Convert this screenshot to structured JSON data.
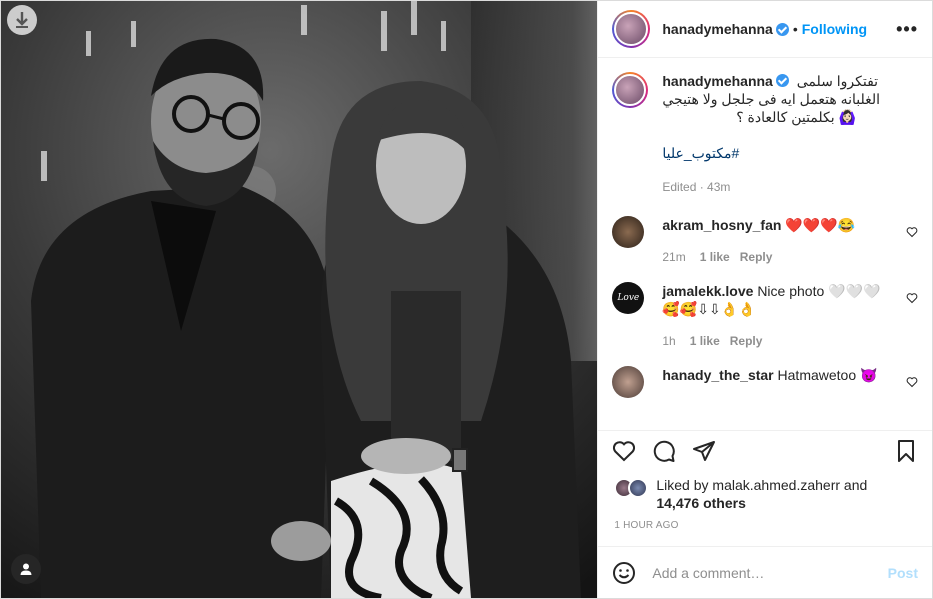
{
  "post": {
    "author": "hanadymehanna",
    "follow_status": "Following",
    "separator": "•",
    "more_label": "•••"
  },
  "caption": {
    "author": "hanadymehanna",
    "line1": "تفتكروا سلمى",
    "line2": "الغلبانه هتعمل ايه فى جلجل ولا هتيجي",
    "line3": "بكلمتين كالعادة ؟",
    "emoji": "🙆🏻‍♀️",
    "hashtag": "#مكتوب_عليا",
    "edited": "Edited · 43m"
  },
  "comments": [
    {
      "user": "akram_hosny_fan",
      "text": "❤️❤️❤️😂",
      "time": "21m",
      "likes": "1 like",
      "reply": "Reply"
    },
    {
      "user": "jamalekk.love",
      "text": "Nice photo 🤍🤍🤍",
      "text2": "🥰🥰⇩⇩👌👌",
      "time": "1h",
      "likes": "1 like",
      "reply": "Reply"
    },
    {
      "user": "hanady_the_star",
      "text": "Hatmawetoo 😈"
    }
  ],
  "likes": {
    "prefix": "Liked by",
    "user": "malak.ahmed.zaherr",
    "and": "and",
    "others": "14,476 others"
  },
  "timestamp": "1 HOUR AGO",
  "add_comment": {
    "placeholder": "Add a comment…",
    "post_label": "Post"
  },
  "icons": {
    "download": "download-arrow-icon",
    "tagged_user": "user-tag-icon",
    "like": "heart-icon",
    "comment": "comment-icon",
    "share": "paper-plane-icon",
    "save": "bookmark-icon",
    "emoji": "smiley-icon"
  },
  "colors": {
    "link": "#0095f6",
    "hashtag": "#00376b",
    "muted": "#8e8e8e",
    "post_disabled": "#b2dffc",
    "verified": "#3897f0"
  }
}
